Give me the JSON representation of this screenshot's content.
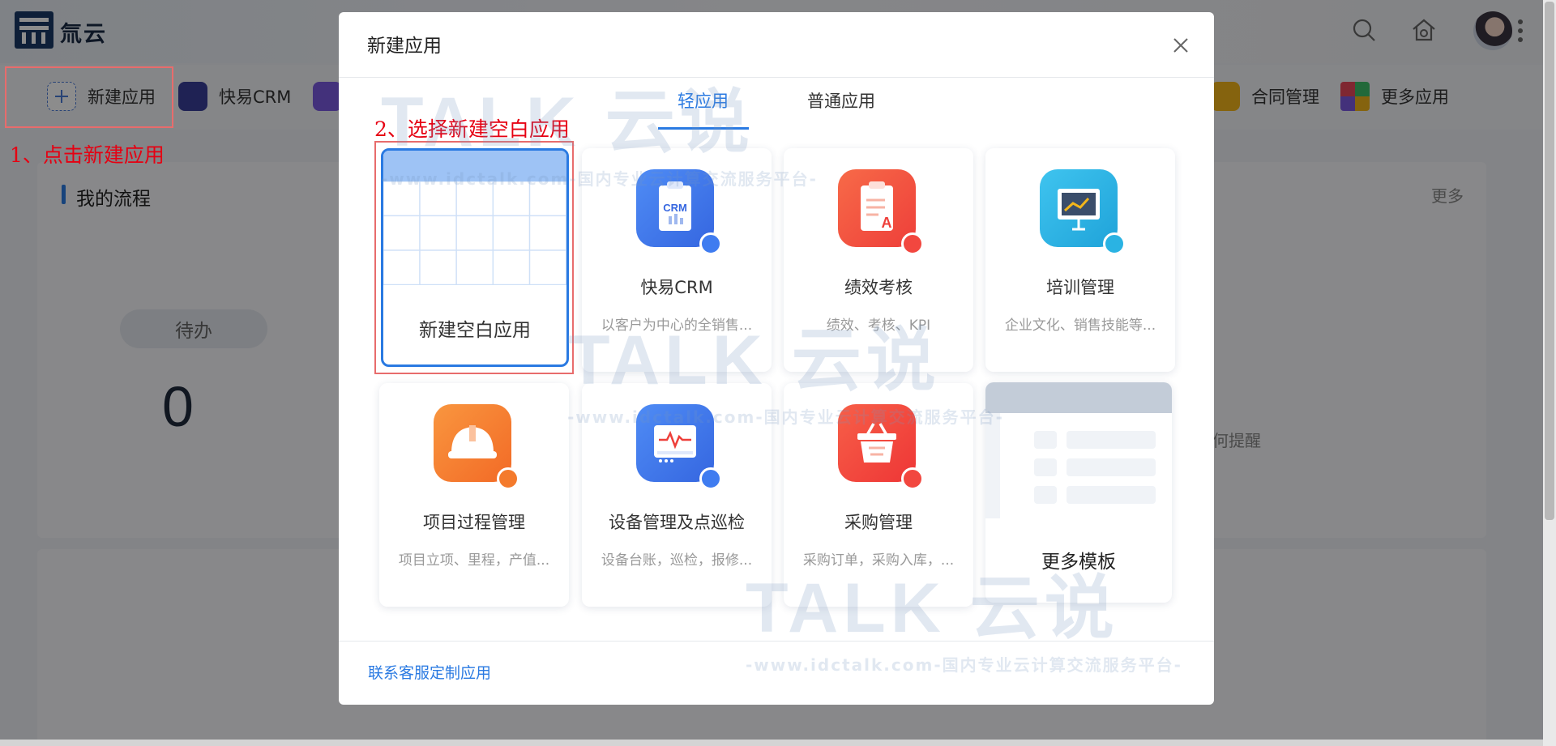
{
  "header": {
    "logo_text": "氚云"
  },
  "app_bar": {
    "new_app_label": "新建应用",
    "crm_label": "快易CRM",
    "contract_label": "合同管理",
    "more_apps_label": "更多应用"
  },
  "annotations": {
    "step1": "1、点击新建应用",
    "step2": "2、选择新建空白应用"
  },
  "panel": {
    "title": "我的流程",
    "more": "更多",
    "todo_label": "待办",
    "todo_count": "0",
    "remind_partial": "何提醒"
  },
  "modal": {
    "title": "新建应用",
    "tabs": [
      {
        "label": "轻应用",
        "active": true
      },
      {
        "label": "普通应用",
        "active": false
      }
    ],
    "blank_app_label": "新建空白应用",
    "templates": [
      {
        "name": "快易CRM",
        "desc": "以客户为中心的全销售...",
        "icon": "crm-clipboard-icon",
        "color": "#3f7cf0"
      },
      {
        "name": "绩效考核",
        "desc": "绩效、考核、KPI",
        "icon": "grade-clipboard-icon",
        "color": "#f25a3f"
      },
      {
        "name": "培训管理",
        "desc": "企业文化、销售技能等...",
        "icon": "presentation-board-icon",
        "color": "#2ab3e3"
      },
      {
        "name": "项目过程管理",
        "desc": "项目立项、里程，产值...",
        "icon": "hard-hat-icon",
        "color": "#f47a2c"
      },
      {
        "name": "设备管理及点巡检",
        "desc": "设备台账，巡检，报修...",
        "icon": "equipment-monitor-icon",
        "color": "#3f7cf0"
      },
      {
        "name": "采购管理",
        "desc": "采购订单，采购入库，...",
        "icon": "shopping-basket-icon",
        "color": "#f2473f"
      }
    ],
    "more_templates_label": "更多模板",
    "footer_link": "联系客服定制应用"
  },
  "watermark": {
    "brand": "TALK 云说",
    "tagline": "-www.idctalk.com-国内专业云计算交流服务平台-"
  }
}
